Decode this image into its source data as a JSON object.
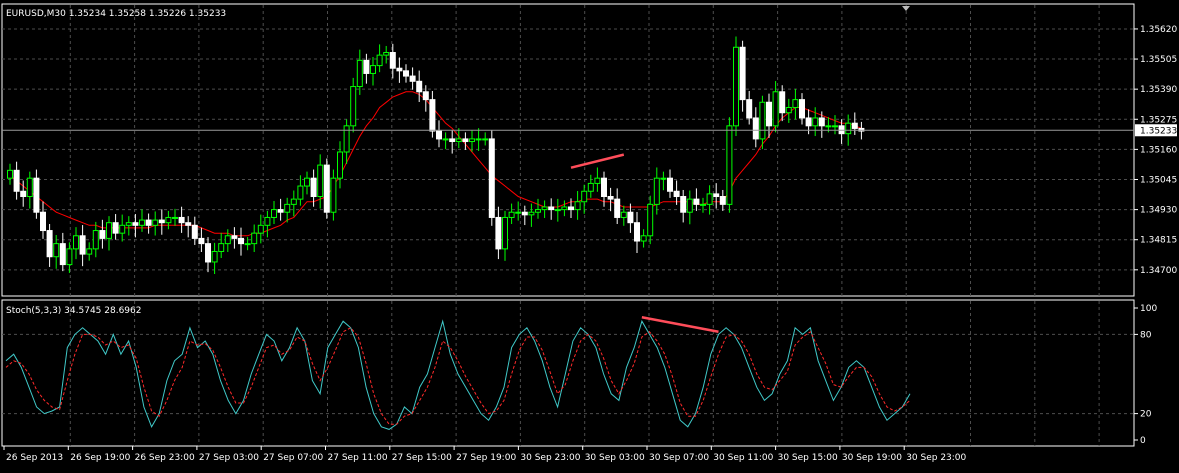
{
  "main_label": "EURUSD,M30  1.35234 1.35258 1.35226 1.35233",
  "stoch_label": "Stoch(5,3,3) 34.5745 28.6962",
  "colors": {
    "background": "#000000",
    "grid": "#4d4d4d",
    "axis": "#ffffff",
    "bull": "#00ff00",
    "bear": "#ffffff",
    "ma": "#ff0000",
    "stoch_main": "#40c8c8",
    "stoch_signal": "#ff2a2a",
    "divergence": "#ff4d5a",
    "current_price_box": "#ffffff"
  },
  "chart_data": [
    {
      "type": "candlestick",
      "grid": true,
      "ylim": [
        1.346,
        1.357
      ],
      "y_ticks": [
        "1.35620",
        "1.35505",
        "1.35390",
        "1.35275",
        "1.35160",
        "1.35045",
        "1.34930",
        "1.34815",
        "1.34700"
      ],
      "current_price": "1.35233",
      "x_ticks": [
        "26 Sep 2013",
        "26 Sep 19:00",
        "26 Sep 23:00",
        "27 Sep 03:00",
        "27 Sep 07:00",
        "27 Sep 11:00",
        "27 Sep 15:00",
        "27 Sep 19:00",
        "30 Sep 23:00",
        "30 Sep 03:00",
        "30 Sep 07:00",
        "30 Sep 11:00",
        "30 Sep 15:00",
        "30 Sep 19:00",
        "30 Sep 23:00"
      ],
      "close": [
        1.3508,
        1.35,
        1.3498,
        1.3505,
        1.3492,
        1.3485,
        1.3475,
        1.348,
        1.3472,
        1.3478,
        1.3483,
        1.3476,
        1.3478,
        1.3485,
        1.3482,
        1.3488,
        1.3484,
        1.3487,
        1.3488,
        1.3487,
        1.3489,
        1.3487,
        1.3489,
        1.3488,
        1.349,
        1.349,
        1.3488,
        1.3487,
        1.3482,
        1.348,
        1.3473,
        1.3477,
        1.348,
        1.3483,
        1.3482,
        1.348,
        1.348,
        1.3484,
        1.3487,
        1.349,
        1.3493,
        1.3492,
        1.3495,
        1.3497,
        1.3502,
        1.3505,
        1.3498,
        1.351,
        1.3492,
        1.3505,
        1.3515,
        1.3525,
        1.354,
        1.355,
        1.3545,
        1.3548,
        1.3552,
        1.3553,
        1.3547,
        1.3546,
        1.3544,
        1.3542,
        1.3538,
        1.3535,
        1.3523,
        1.352,
        1.352,
        1.3519,
        1.352,
        1.3519,
        1.352,
        1.352,
        1.352,
        1.349,
        1.3478,
        1.349,
        1.3492,
        1.3492,
        1.3491,
        1.3492,
        1.3493,
        1.3494,
        1.3493,
        1.3493,
        1.3494,
        1.3493,
        1.3496,
        1.35,
        1.3503,
        1.3505,
        1.3498,
        1.3497,
        1.349,
        1.3492,
        1.3488,
        1.3481,
        1.3483,
        1.3495,
        1.3505,
        1.3505,
        1.35,
        1.3498,
        1.3492,
        1.3497,
        1.3495,
        1.3495,
        1.3499,
        1.3498,
        1.3495,
        1.3525,
        1.3555,
        1.3535,
        1.3528,
        1.352,
        1.3534,
        1.3525,
        1.3538,
        1.353,
        1.3532,
        1.3535,
        1.3528,
        1.3525,
        1.3528,
        1.3525,
        1.3525,
        1.3525,
        1.3522,
        1.3526,
        1.3524,
        1.3523
      ],
      "ma_series": [
        1.3506,
        1.3504,
        1.3502,
        1.35,
        1.3498,
        1.3496,
        1.3494,
        1.3492,
        1.3491,
        1.349,
        1.3489,
        1.3488,
        1.3487,
        1.3487,
        1.3486,
        1.3486,
        1.3486,
        1.3486,
        1.3486,
        1.3486,
        1.3486,
        1.3486,
        1.3487,
        1.3487,
        1.3487,
        1.3487,
        1.3487,
        1.3487,
        1.3487,
        1.3486,
        1.3485,
        1.3484,
        1.3484,
        1.3484,
        1.3483,
        1.3483,
        1.3483,
        1.3484,
        1.3484,
        1.3485,
        1.3486,
        1.3487,
        1.3489,
        1.349,
        1.3493,
        1.3496,
        1.3496,
        1.3497,
        1.3498,
        1.3502,
        1.3506,
        1.3511,
        1.3516,
        1.3521,
        1.3525,
        1.3528,
        1.3532,
        1.3534,
        1.3536,
        1.3537,
        1.3538,
        1.3538,
        1.3537,
        1.3535,
        1.3532,
        1.3529,
        1.3526,
        1.3524,
        1.3521,
        1.3518,
        1.3515,
        1.3512,
        1.3509,
        1.3506,
        1.3504,
        1.3502,
        1.35,
        1.3498,
        1.3497,
        1.3496,
        1.3495,
        1.3494,
        1.3494,
        1.3494,
        1.3495,
        1.3496,
        1.3496,
        1.3497,
        1.3497,
        1.3497,
        1.3496,
        1.3496,
        1.3495,
        1.3494,
        1.3494,
        1.3494,
        1.3494,
        1.3494,
        1.3495,
        1.3496,
        1.3496,
        1.3496,
        1.3496,
        1.3496,
        1.3495,
        1.3495,
        1.3496,
        1.3496,
        1.3496,
        1.35,
        1.3505,
        1.3508,
        1.3511,
        1.3514,
        1.3518,
        1.3521,
        1.3525,
        1.3528,
        1.353,
        1.3532,
        1.3532,
        1.3531,
        1.353,
        1.3529,
        1.3528,
        1.3527,
        1.3526,
        1.3526,
        1.3525,
        1.3524
      ],
      "divergence_line": {
        "from": [
          85,
          1.3509
        ],
        "to": [
          93,
          1.3514
        ]
      }
    },
    {
      "type": "line",
      "grid": true,
      "ylim": [
        0,
        100
      ],
      "y_ticks": [
        "100",
        "80",
        "20",
        "0"
      ],
      "series": [
        {
          "values": [
            60,
            65,
            55,
            40,
            25,
            20,
            22,
            25,
            70,
            80,
            85,
            80,
            75,
            65,
            80,
            65,
            75,
            55,
            25,
            10,
            20,
            45,
            60,
            65,
            85,
            70,
            75,
            65,
            45,
            30,
            20,
            30,
            50,
            65,
            80,
            75,
            60,
            70,
            85,
            75,
            45,
            35,
            70,
            80,
            90,
            85,
            70,
            40,
            20,
            10,
            8,
            12,
            25,
            20,
            40,
            50,
            70,
            90,
            65,
            50,
            40,
            30,
            20,
            15,
            25,
            40,
            70,
            80,
            85,
            75,
            60,
            40,
            25,
            50,
            75,
            85,
            80,
            70,
            50,
            35,
            30,
            55,
            70,
            90,
            80,
            70,
            55,
            35,
            15,
            10,
            20,
            40,
            65,
            80,
            85,
            80,
            70,
            55,
            40,
            30,
            35,
            50,
            60,
            85,
            80,
            85,
            60,
            45,
            30,
            40,
            55,
            60,
            55,
            40,
            25,
            15,
            20,
            25,
            35
          ]
        },
        {
          "values": [
            55,
            60,
            58,
            50,
            38,
            30,
            25,
            23,
            45,
            65,
            80,
            80,
            78,
            72,
            75,
            70,
            72,
            62,
            40,
            22,
            18,
            30,
            45,
            55,
            75,
            72,
            73,
            68,
            55,
            40,
            28,
            28,
            40,
            55,
            70,
            72,
            65,
            68,
            78,
            75,
            58,
            45,
            55,
            68,
            82,
            85,
            78,
            58,
            35,
            20,
            12,
            12,
            18,
            20,
            30,
            40,
            55,
            75,
            70,
            60,
            48,
            38,
            28,
            20,
            22,
            30,
            50,
            68,
            78,
            78,
            68,
            52,
            35,
            42,
            60,
            75,
            80,
            75,
            62,
            45,
            35,
            45,
            58,
            78,
            82,
            75,
            65,
            48,
            28,
            18,
            18,
            30,
            48,
            65,
            78,
            80,
            75,
            65,
            50,
            40,
            38,
            45,
            52,
            72,
            78,
            82,
            70,
            58,
            42,
            40,
            48,
            55,
            55,
            48,
            35,
            25,
            22,
            25,
            30
          ]
        }
      ],
      "divergence_line": {
        "from": [
          83,
          93
        ],
        "to": [
          93,
          82
        ]
      }
    }
  ]
}
